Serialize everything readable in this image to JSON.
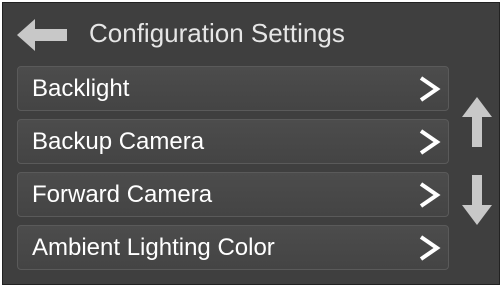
{
  "header": {
    "title": "Configuration Settings",
    "back_icon": "left-arrow-icon"
  },
  "menu": {
    "items": [
      {
        "label": "Backlight",
        "icon": "chevron-right-icon"
      },
      {
        "label": "Backup Camera",
        "icon": "chevron-right-icon"
      },
      {
        "label": "Forward Camera",
        "icon": "chevron-right-icon"
      },
      {
        "label": "Ambient Lighting Color",
        "icon": "chevron-right-icon"
      }
    ]
  },
  "scroll": {
    "up_icon": "up-arrow-icon",
    "down_icon": "down-arrow-icon"
  },
  "colors": {
    "background": "#3f3f3f",
    "item_background": "#474747",
    "text": "#ffffff",
    "icon": "#d0d0d0"
  }
}
